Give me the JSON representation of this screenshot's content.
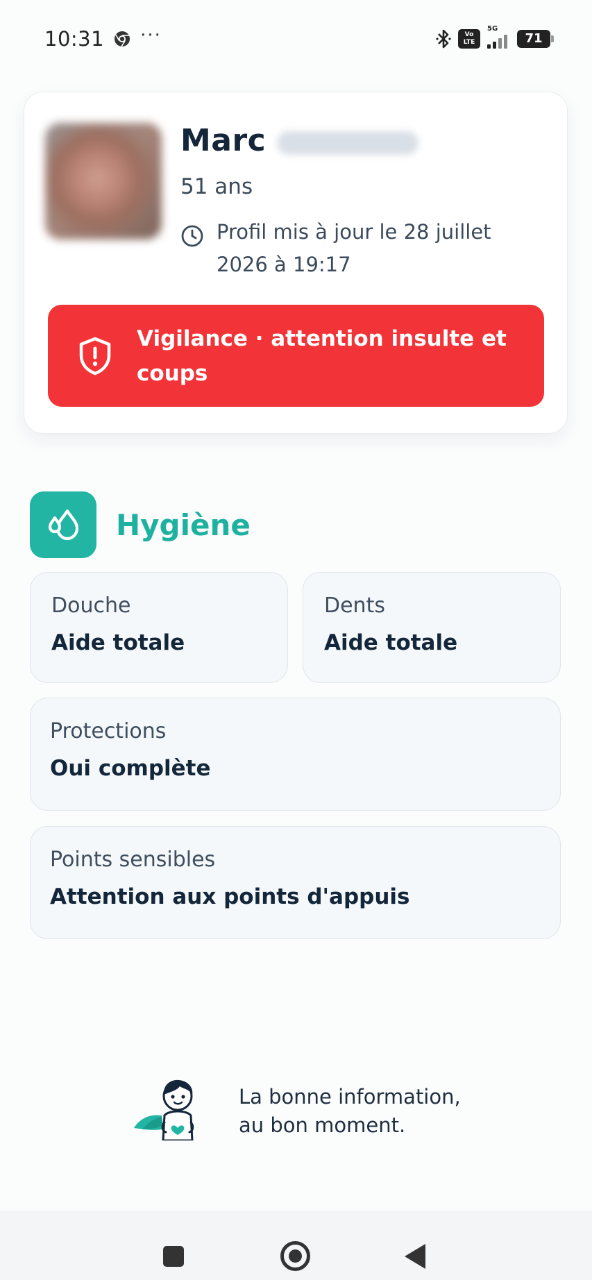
{
  "status_bar": {
    "time": "10:31",
    "dots": "···",
    "volte_top": "Vo",
    "volte_bottom": "LTE",
    "network": "5G",
    "battery": "71"
  },
  "profile": {
    "first_name": "Marc",
    "age": "51 ans",
    "updated": "Profil mis à jour le 28 juillet 2026 à 19:17",
    "alert": "Vigilance · attention insulte et coups"
  },
  "hygiene": {
    "title": "Hygiène",
    "douche": {
      "label": "Douche",
      "value": "Aide totale"
    },
    "dents": {
      "label": "Dents",
      "value": "Aide totale"
    },
    "protections": {
      "label": "Protections",
      "value": "Oui complète"
    },
    "points_sensibles": {
      "label": "Points sensibles",
      "value": "Attention aux points d'appuis"
    }
  },
  "footer": {
    "tagline_line1": "La bonne information,",
    "tagline_line2": "au bon moment."
  },
  "colors": {
    "alert_red": "#f23337",
    "accent_teal": "#22b5a3",
    "text_dark": "#15263a"
  },
  "icons": {
    "status_chrome": "chrome-icon",
    "bluetooth": "bluetooth-icon",
    "clock": "clock-icon",
    "shield": "shield-alert-icon",
    "hygiene": "water-drops-icon",
    "mascot": "superhero-mascot-icon"
  }
}
